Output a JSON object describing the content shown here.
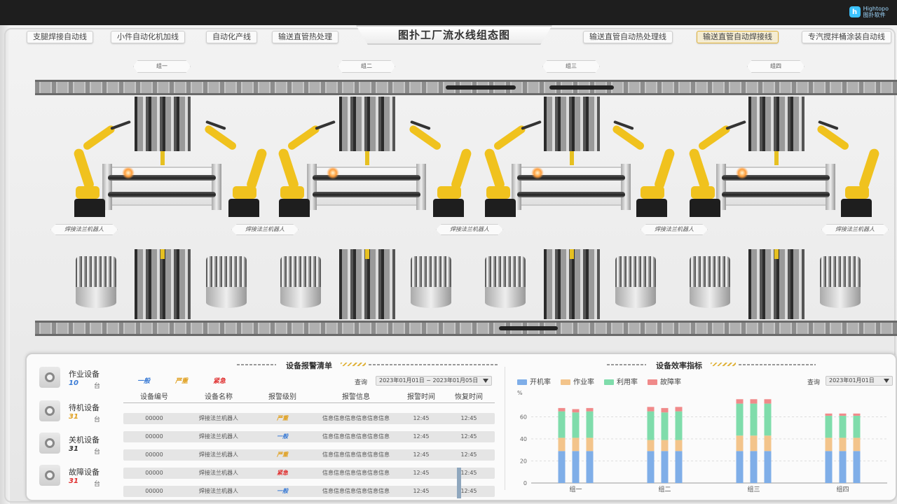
{
  "brand": {
    "logo_line1": "Hightopo",
    "logo_line2": "图扑软件"
  },
  "title": "图扑工厂流水线组态图",
  "tabs": [
    {
      "label": "支腿焊接自动线"
    },
    {
      "label": "小件自动化机加线"
    },
    {
      "label": "自动化产线"
    },
    {
      "label": "输送直管热处理"
    },
    {
      "label": "输送直管自动热处理线"
    },
    {
      "label": "输送直管自动焊接线",
      "active": true
    },
    {
      "label": "专汽搅拌桶涂装自动线"
    }
  ],
  "groups": [
    "组一",
    "组二",
    "组三",
    "组四"
  ],
  "robot_label": "焊接法兰机器人",
  "devices": [
    {
      "name": "作业设备",
      "count": "10",
      "unit": "台",
      "color": "#3a7bd5"
    },
    {
      "name": "待机设备",
      "count": "31",
      "unit": "台",
      "color": "#e0a020"
    },
    {
      "name": "关机设备",
      "count": "31",
      "unit": "台",
      "color": "#333333"
    },
    {
      "name": "故障设备",
      "count": "31",
      "unit": "台",
      "color": "#e03030"
    }
  ],
  "alarm": {
    "title": "设备报警清单",
    "levels": [
      {
        "label": "一般",
        "color": "#3a7bd5"
      },
      {
        "label": "严重",
        "color": "#e0a020"
      },
      {
        "label": "紧急",
        "color": "#e03030"
      }
    ],
    "query_label": "查询",
    "date_range": "2023年01月01日 ~ 2023年01月05日",
    "columns": [
      "设备编号",
      "设备名称",
      "报警级别",
      "报警信息",
      "报警时间",
      "恢复时间"
    ],
    "rows": [
      {
        "id": "00000",
        "name": "焊接法兰机器人",
        "level": "严重",
        "level_color": "#e0a020",
        "info": "信息信息信息信息信息信息",
        "time": "12:45",
        "recover": "12:45"
      },
      {
        "id": "00000",
        "name": "焊接法兰机器人",
        "level": "一般",
        "level_color": "#3a7bd5",
        "info": "信息信息信息信息信息信息",
        "time": "12:45",
        "recover": "12:45"
      },
      {
        "id": "00000",
        "name": "焊接法兰机器人",
        "level": "严重",
        "level_color": "#e0a020",
        "info": "信息信息信息信息信息信息",
        "time": "12:45",
        "recover": "12:45"
      },
      {
        "id": "00000",
        "name": "焊接法兰机器人",
        "level": "紧急",
        "level_color": "#e03030",
        "info": "信息信息信息信息信息信息",
        "time": "12:45",
        "recover": "12:45"
      },
      {
        "id": "00000",
        "name": "焊接法兰机器人",
        "level": "一般",
        "level_color": "#3a7bd5",
        "info": "信息信息信息信息信息信息",
        "time": "12:45",
        "recover": "12:45"
      }
    ]
  },
  "efficiency": {
    "title": "设备效率指标",
    "query_label": "查询",
    "date": "2023年01月01日",
    "unit_label": "%"
  },
  "chart_data": {
    "type": "bar",
    "stacked": true,
    "categories": [
      "组一",
      "组二",
      "组三",
      "组四"
    ],
    "bars_per_category": 3,
    "ylim": [
      0,
      80
    ],
    "yticks": [
      0,
      20,
      40,
      60
    ],
    "series": [
      {
        "name": "开机率",
        "color": "#7faee8",
        "values": [
          [
            29,
            29,
            29
          ],
          [
            29,
            29,
            29
          ],
          [
            29,
            29,
            29
          ],
          [
            29,
            29,
            29
          ]
        ]
      },
      {
        "name": "作业率",
        "color": "#f3c48b",
        "values": [
          [
            12,
            12,
            12
          ],
          [
            10,
            10,
            10
          ],
          [
            14,
            14,
            14
          ],
          [
            12,
            12,
            12
          ]
        ]
      },
      {
        "name": "利用率",
        "color": "#7fdcab",
        "values": [
          [
            24,
            23,
            24
          ],
          [
            26,
            25,
            26
          ],
          [
            29,
            29,
            29
          ],
          [
            20,
            20,
            20
          ]
        ]
      },
      {
        "name": "故障率",
        "color": "#f08a8a",
        "values": [
          [
            3,
            3,
            3
          ],
          [
            4,
            4,
            4
          ],
          [
            4,
            4,
            4
          ],
          [
            2,
            2,
            2
          ]
        ]
      }
    ]
  }
}
